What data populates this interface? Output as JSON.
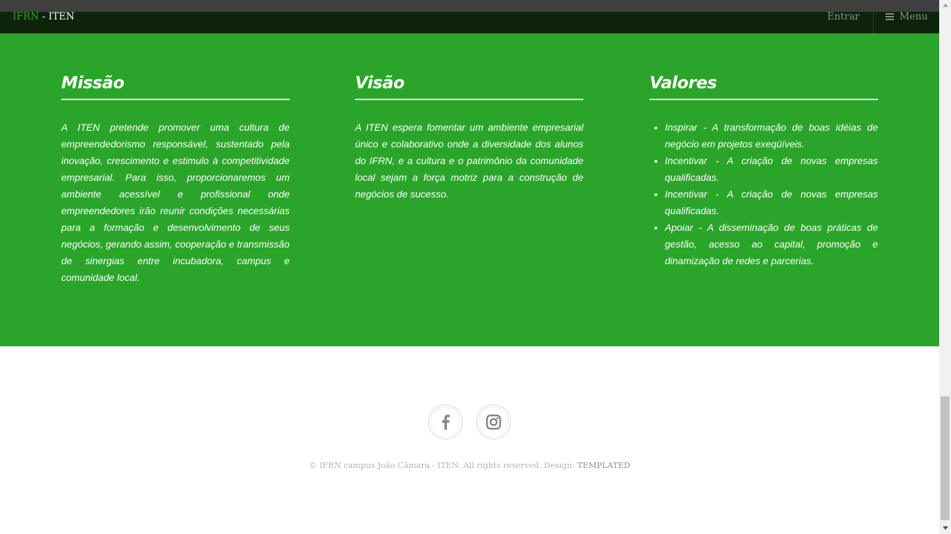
{
  "header": {
    "brand": "IFRN",
    "brand_suffix": " - ITEN",
    "nav_login": "Entrar",
    "nav_menu": "Menu",
    "brand_color": "#2ca52b",
    "bar_color": "#0d230b"
  },
  "section": {
    "background": "#2aa52a",
    "missao": {
      "title": "Missão",
      "text": "A ITEN pretende promover uma cultura de empreendedorismo responsável, sustentado pela inovação, crescimento e estimulo à competitividade empresarial. Para isso, proporcionaremos um ambiente acessível e profissional onde empreendedores irão reunir condições necessárias para a formação e desenvolvimento de seus negócios, gerando assim, cooperação e transmissão de sinergias entre incubadora, campus e comunidade local."
    },
    "visao": {
      "title": "Visão",
      "text": "A ITEN espera fomentar um ambiente empresarial único e colaborativo onde a diversidade dos alunos do IFRN, e a cultura e o patrimônio da comunidade local sejam a força motriz para a construção de negócios de sucesso."
    },
    "valores": {
      "title": "Valores",
      "items": [
        "Inspirar - A transformação de boas idéias de negócio em projetos exeqüíveis.",
        "Incentivar - A criação de novas empresas qualificadas.",
        "Incentivar - A criação de novas empresas qualificadas.",
        "Apoiar - A disseminação de boas práticas de gestão, acesso ao capital, promoção e dinamização de redes e parcerias."
      ]
    }
  },
  "footer": {
    "social": [
      "facebook-icon",
      "instagram-icon"
    ],
    "copyright": "© IFRN campus João Câmara - ITEN. All rights reserved. Design: ",
    "credit": "TEMPLATED"
  }
}
